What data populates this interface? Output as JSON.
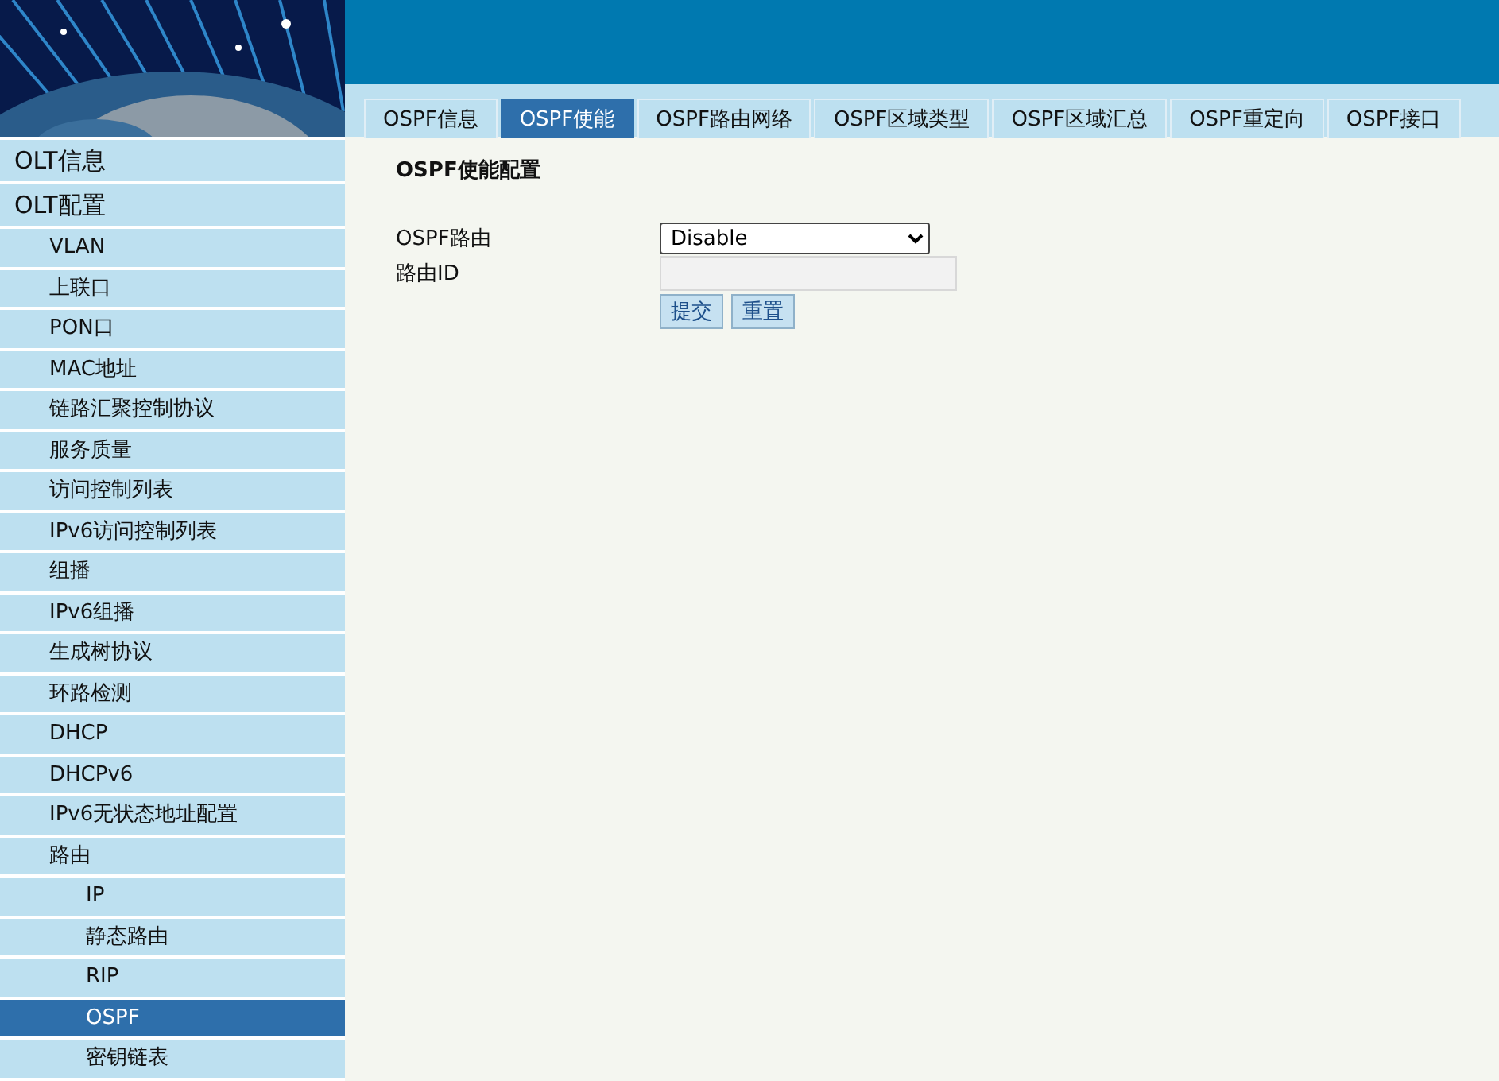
{
  "tabs": [
    {
      "label": "OSPF信息",
      "selected": false
    },
    {
      "label": "OSPF使能",
      "selected": true
    },
    {
      "label": "OSPF路由网络",
      "selected": false
    },
    {
      "label": "OSPF区域类型",
      "selected": false
    },
    {
      "label": "OSPF区域汇总",
      "selected": false
    },
    {
      "label": "OSPF重定向",
      "selected": false
    },
    {
      "label": "OSPF接口",
      "selected": false
    }
  ],
  "sidebar": {
    "items": [
      {
        "label": "OLT信息",
        "selected": false
      },
      {
        "label": "OLT配置",
        "selected": false,
        "children": [
          {
            "label": "VLAN",
            "selected": false
          },
          {
            "label": "上联口",
            "selected": false
          },
          {
            "label": "PON口",
            "selected": false
          },
          {
            "label": "MAC地址",
            "selected": false
          },
          {
            "label": "链路汇聚控制协议",
            "selected": false
          },
          {
            "label": "服务质量",
            "selected": false
          },
          {
            "label": "访问控制列表",
            "selected": false
          },
          {
            "label": "IPv6访问控制列表",
            "selected": false
          },
          {
            "label": "组播",
            "selected": false
          },
          {
            "label": "IPv6组播",
            "selected": false
          },
          {
            "label": "生成树协议",
            "selected": false
          },
          {
            "label": "环路检测",
            "selected": false
          },
          {
            "label": "DHCP",
            "selected": false
          },
          {
            "label": "DHCPv6",
            "selected": false
          },
          {
            "label": "IPv6无状态地址配置",
            "selected": false
          },
          {
            "label": "路由",
            "selected": false,
            "children": [
              {
                "label": "IP",
                "selected": false
              },
              {
                "label": "静态路由",
                "selected": false
              },
              {
                "label": "RIP",
                "selected": false
              },
              {
                "label": "OSPF",
                "selected": true
              },
              {
                "label": "密钥链表",
                "selected": false
              }
            ]
          }
        ]
      }
    ]
  },
  "form": {
    "title": "OSPF使能配置",
    "fields": [
      {
        "kind": "select",
        "label": "OSPF路由",
        "value": "Disable"
      },
      {
        "kind": "text",
        "label": "路由ID",
        "disabled": true
      }
    ],
    "buttons": [
      "提交",
      "重置"
    ]
  }
}
